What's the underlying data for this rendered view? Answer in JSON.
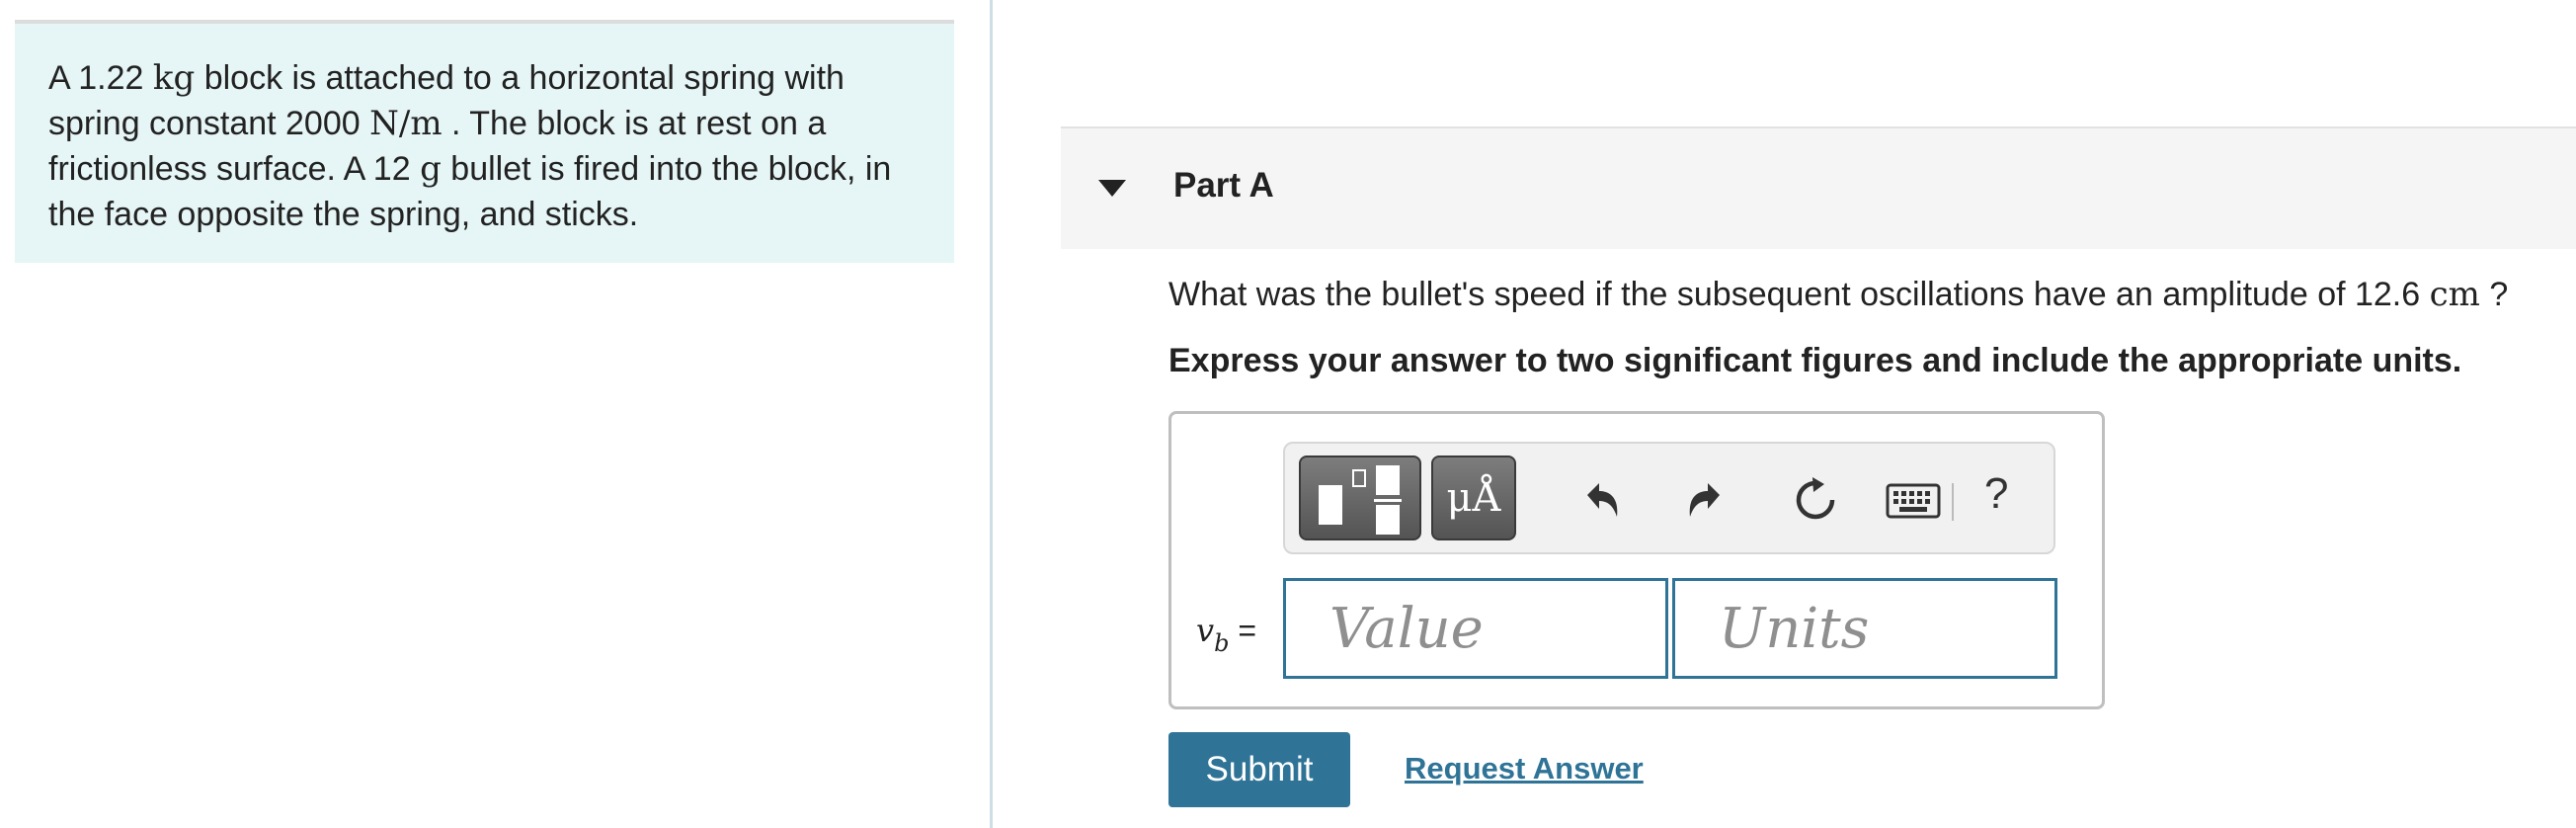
{
  "problem": {
    "t1": "A 1.22 ",
    "u1": "kg",
    "t2": " block is attached to a horizontal spring with spring constant 2000 ",
    "u2": "N/m",
    "t3": " . The block is at rest on a frictionless surface. A 12 ",
    "u3": "g",
    "t4": " bullet is fired into the block, in the face opposite the spring, and sticks."
  },
  "part": {
    "title": "Part A"
  },
  "question": {
    "text": "What was the bullet's speed if the subsequent oscillations have an amplitude of 12.6 ",
    "unit": "cm",
    "end": " ?"
  },
  "instructions": "Express your answer to two significant figures and include the appropriate units.",
  "toolbar": {
    "units_button_label": "μÅ",
    "help_label": "?",
    "icons": [
      "templates-icon",
      "units-icon",
      "undo-icon",
      "redo-icon",
      "reset-icon",
      "keyboard-icon",
      "help-icon"
    ]
  },
  "answer": {
    "variable": "v",
    "subscript": "b",
    "equals": " =",
    "value_placeholder": "Value",
    "units_placeholder": "Units"
  },
  "actions": {
    "submit_label": "Submit",
    "request_answer_label": "Request Answer"
  },
  "colors": {
    "accent": "#2f7497",
    "problem_background": "#e6f5f5",
    "part_header_background": "#f5f5f5"
  }
}
